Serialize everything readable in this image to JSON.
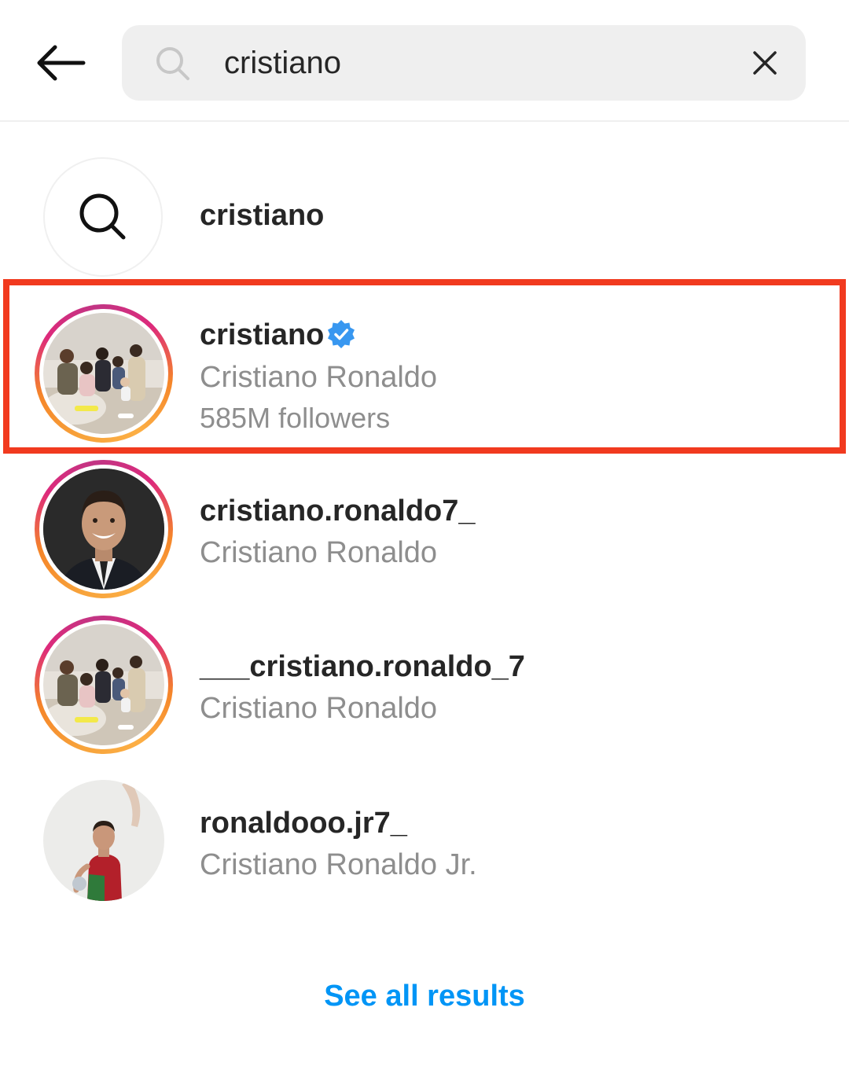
{
  "header": {
    "back_icon": "arrow-left-icon",
    "search_icon": "search-icon",
    "search_query": "cristiano",
    "clear_icon": "close-icon"
  },
  "keyword_suggestion": {
    "icon": "search-icon",
    "text": "cristiano"
  },
  "results": [
    {
      "username": "cristiano",
      "verified": true,
      "full_name": "Cristiano Ronaldo",
      "followers": "585M followers",
      "has_story_ring": true,
      "avatar": "family-photo",
      "highlighted": true
    },
    {
      "username": "cristiano.ronaldo7_",
      "verified": false,
      "full_name": "Cristiano Ronaldo",
      "has_story_ring": true,
      "avatar": "portrait-suit"
    },
    {
      "username": "___cristiano.ronaldo_7",
      "verified": false,
      "full_name": "Cristiano Ronaldo",
      "has_story_ring": true,
      "avatar": "family-photo"
    },
    {
      "username": "ronaldooo.jr7_",
      "verified": false,
      "full_name": "Cristiano Ronaldo Jr.",
      "has_story_ring": false,
      "avatar": "kid-jersey"
    }
  ],
  "see_all_label": "See all results",
  "colors": {
    "highlight_border": "#f13a1f",
    "link_blue": "#0095f6",
    "verified_blue": "#3897f0",
    "secondary_text": "#8e8e8e",
    "primary_text": "#262626",
    "search_bg": "#efefef"
  }
}
